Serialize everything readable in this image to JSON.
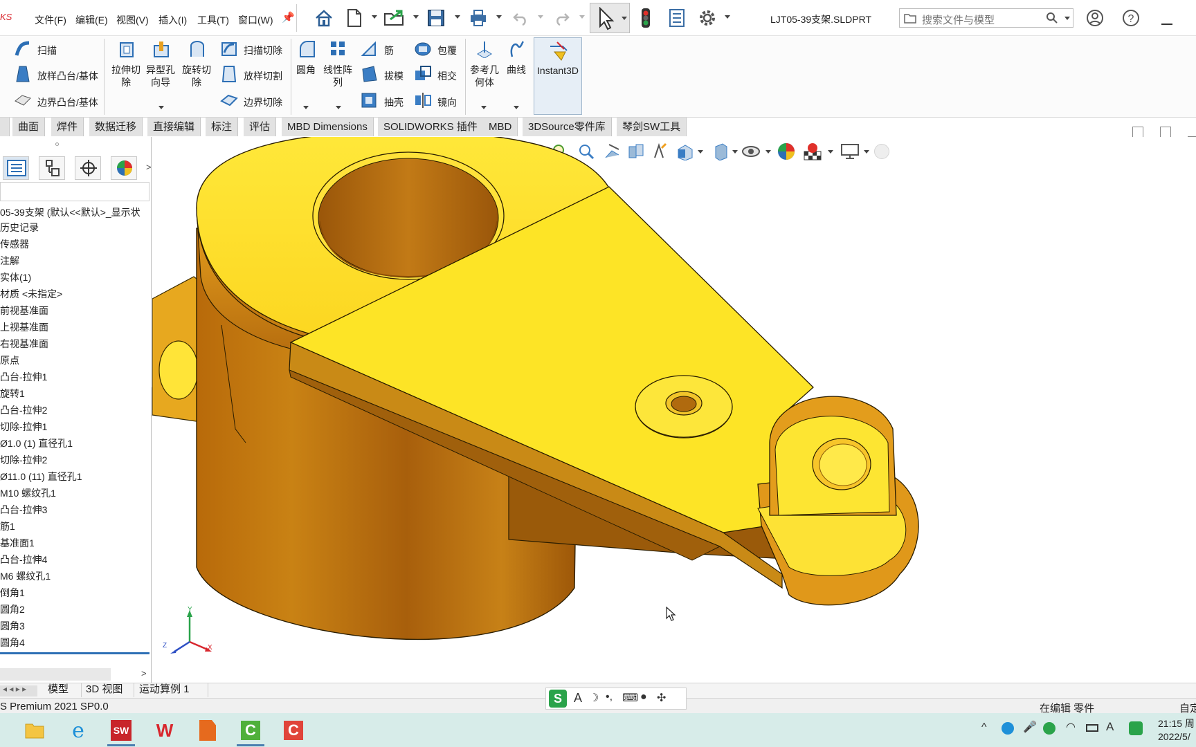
{
  "app": {
    "logo_text": "KS",
    "document_title": "LJT05-39支架.SLDPRT"
  },
  "menu": {
    "items": [
      "文件(F)",
      "编辑(E)",
      "视图(V)",
      "插入(I)",
      "工具(T)",
      "窗口(W)"
    ]
  },
  "search": {
    "placeholder": "搜索文件与模型"
  },
  "ribbon": {
    "sweep": "扫描",
    "loft_boss": "放样凸台/基体",
    "boundary_boss": "边界凸台/基体",
    "extrude_cut_1": "拉伸切",
    "extrude_cut_2": "除",
    "hole_wizard_1": "异型孔",
    "hole_wizard_2": "向导",
    "revolve_cut_1": "旋转切",
    "revolve_cut_2": "除",
    "swept_cut": "扫描切除",
    "lofted_cut": "放样切割",
    "boundary_cut": "边界切除",
    "fillet": "圆角",
    "linear_pattern_1": "线性阵",
    "linear_pattern_2": "列",
    "rib": "筋",
    "wrap": "包覆",
    "draft": "拔模",
    "intersect": "相交",
    "shell": "抽壳",
    "mirror": "镜向",
    "ref_geometry_1": "参考几",
    "ref_geometry_2": "何体",
    "curves": "曲线",
    "instant3d": "Instant3D"
  },
  "tabs": [
    "曲面",
    "焊件",
    "数据迁移",
    "直接编辑",
    "标注",
    "评估",
    "MBD Dimensions",
    "SOLIDWORKS 插件",
    "MBD",
    "3DSource零件库",
    "琴剑SW工具"
  ],
  "feature_tree": {
    "root": "05-39支架 (默认<<默认>_显示状",
    "items": [
      "历史记录",
      "传感器",
      "注解",
      "实体(1)",
      "材质 <未指定>",
      "前视基准面",
      "上视基准面",
      "右视基准面",
      "原点",
      "凸台-拉伸1",
      "旋转1",
      "凸台-拉伸2",
      "切除-拉伸1",
      "Ø1.0 (1) 直径孔1",
      "切除-拉伸2",
      "Ø11.0 (11) 直径孔1",
      "M10 螺纹孔1",
      "凸台-拉伸3",
      "筋1",
      "基准面1",
      "凸台-拉伸4",
      "M6 螺纹孔1",
      "倒角1",
      "圆角2",
      "圆角3",
      "圆角4"
    ]
  },
  "triad": {
    "x": "X",
    "y": "Y",
    "z": "Z"
  },
  "bottom_tabs": [
    "模型",
    "3D 视图",
    "运动算例 1"
  ],
  "status": {
    "product": "S Premium 2021 SP0.0",
    "mode": "在编辑 零件",
    "right": "自定"
  },
  "taskbar": {
    "time": "21:15 周",
    "date": "2022/5/"
  },
  "colors": {
    "part_face": "#fde426",
    "part_side": "#c67a10",
    "accent": "#2d6fb5"
  }
}
